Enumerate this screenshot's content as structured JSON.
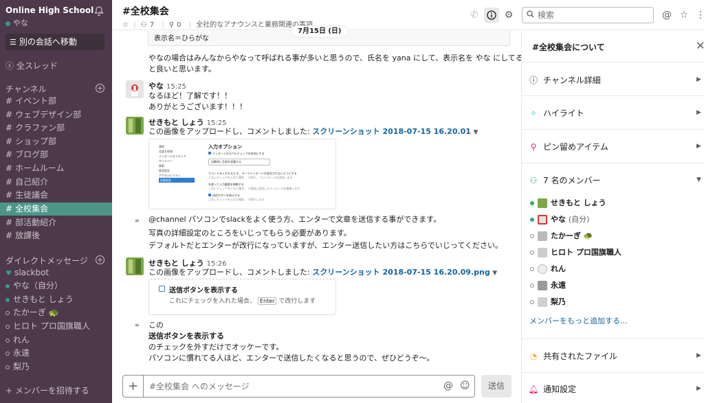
{
  "workspace": {
    "name": "Online High School",
    "user": "やな"
  },
  "sidebar": {
    "jump_label": "別の会話へ移動",
    "all_threads": "全スレッド",
    "channels_title": "チャンネル",
    "channels": [
      "イベント部",
      "ウェブデザイン部",
      "クラファン部",
      "ショップ部",
      "ブログ部",
      "ホームルーム",
      "自己紹介",
      "生徒議会",
      "全校集会",
      "部活動紹介",
      "放課後"
    ],
    "active_channel": "全校集会",
    "dm_title": "ダイレクトメッセージ",
    "dms": [
      {
        "name": "slackbot",
        "status": "bot"
      },
      {
        "name": "やな（自分）",
        "status": "online"
      },
      {
        "name": "せきもと しょう",
        "status": "online"
      },
      {
        "name": "たかーぎ 🐢",
        "status": "offline"
      },
      {
        "name": "ヒロト プロ国旗職人",
        "status": "offline"
      },
      {
        "name": "れん",
        "status": "offline"
      },
      {
        "name": "永遠",
        "status": "offline"
      },
      {
        "name": "梨乃",
        "status": "offline"
      }
    ],
    "invite_label": "メンバーを招待する"
  },
  "header": {
    "channel": "#全校集会",
    "member_count": "7",
    "pin_count": "0",
    "topic": "全社的なアナウンスと業務関連の事項",
    "search_placeholder": "検索"
  },
  "date_divider": "7月15日 (日)",
  "messages": {
    "snippet_text": "表示名＝ひらがな",
    "m0_line1": "やなの場合はみんなからやなって呼ばれる事が多いと思うので、氏名を yana にして、表示名を やな にしてる",
    "m0_line2": "と良いと思います。",
    "m1_name": "やな",
    "m1_time": "15:25",
    "m1_line1": "なるほど！了解です！！",
    "m1_line2": "ありがとうございます！！！",
    "m2_name": "せきもと しょう",
    "m2_time": "15:25",
    "m2_prefix": "この画像をアップロードし、コメントしました: ",
    "m2_file": "スクリーンショット 2018-07-15 16.20.01",
    "shot1": {
      "menu": [
        "通知",
        "言語＆地域",
        "メッセージ＆メディア",
        "サイドバー",
        "検索",
        "既読設定",
        "アクセシビリティ",
        "詳細設定"
      ],
      "title": "入力オプション",
      "opt1": "メッセージのスペルチェックを有効にする",
      "select": "自動的に言語を認識する",
      "opt2": "でコードを入力するとき、 キーでメッセージが送信されないようにする",
      "opt2_sub": "これにチェックを入れた場合、 で改行、 でメッセージを送信します",
      "opt3": "を使って入力履歴を移動する",
      "opt3_sub": "これにチェックを入れた場合、 で直前に送信したメッセージを編集します",
      "opt4": "送信ボタンを表示する",
      "opt4_sub": "これにチェックを入れた場合、 で改行します"
    },
    "m3_line1": "@channel パソコンでslackをよく使う方、エンターで文章を送信する事ができます。",
    "m3_line2": "写真の詳細設定のところをいじってもらう必要があります。",
    "m3_line3": "デフォルトだとエンターが改行になっていますが、エンター送信したい方はこちらでいじってください。",
    "m4_name": "せきもと しょう",
    "m4_time": "15:26",
    "m4_prefix": "この画像をアップロードし、コメントしました: ",
    "m4_file": "スクリーンショット 2018-07-15 16.20.09.png",
    "shot2": {
      "opt": "送信ボタンを表示する",
      "sub": "これにチェックを入れた場合、",
      "key": "Enter",
      "sub2": "で改行します"
    },
    "m5_line1": "この",
    "m5_line2": "送信ボタンを表示する",
    "m5_line3": "のチェックを外すだけでオッケーです。",
    "m5_line4": "パソコンに慣れてる人ほど、エンターで送信したくなると思うので、ぜひどうぞ〜。"
  },
  "composer": {
    "placeholder": "#全校集会 へのメッセージ",
    "send_label": "送信"
  },
  "panel": {
    "title": "#全校集会について",
    "details": "チャンネル詳細",
    "highlights": "ハイライト",
    "pinned": "ピン留めアイテム",
    "members_title": "7 名のメンバー",
    "members": [
      {
        "name": "せきもと しょう",
        "online": true
      },
      {
        "name": "やな",
        "self": "(自分)",
        "online": true
      },
      {
        "name": "たかーぎ 🐢",
        "online": false
      },
      {
        "name": "ヒロト プロ国旗職人",
        "online": false
      },
      {
        "name": "れん",
        "online": false
      },
      {
        "name": "永遠",
        "online": false
      },
      {
        "name": "梨乃",
        "online": false
      }
    ],
    "add_member": "メンバーをもっと追加する...",
    "shared_files": "共有されたファイル",
    "notifications": "通知設定"
  }
}
